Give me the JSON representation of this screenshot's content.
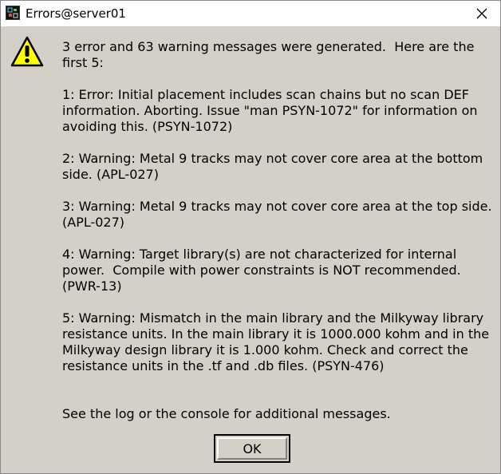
{
  "window": {
    "title": "Errors@server01",
    "app_icon": "terminal-app-icon",
    "close_icon": "close-icon"
  },
  "dialog": {
    "icon": "warning-icon",
    "header": "3 error and 63 warning messages were generated.  Here are the first 5:",
    "messages": [
      "1: Error: Initial placement includes scan chains but no scan DEF information. Aborting. Issue \"man PSYN-1072\" for information on avoiding this. (PSYN-1072)",
      "2: Warning: Metal 9 tracks may not cover core area at the bottom side. (APL-027)",
      "3: Warning: Metal 9 tracks may not cover core area at the top side. (APL-027)",
      "4: Warning: Target library(s) are not characterized for internal power.  Compile with power constraints is NOT recommended. (PWR-13)",
      "5: Warning: Mismatch in the main library and the Milkyway library resistance units. In the main library it is 1000.000 kohm and in the Milkyway design library it is 1.000 kohm. Check and correct the resistance units in the .tf and .db files. (PSYN-476)"
    ],
    "footer": "See the log or the console for additional messages.",
    "ok_label": "OK"
  },
  "colors": {
    "dialog_background": "#d4d0c8",
    "titlebar_background": "#ffffff",
    "warning_yellow": "#ffff00"
  }
}
